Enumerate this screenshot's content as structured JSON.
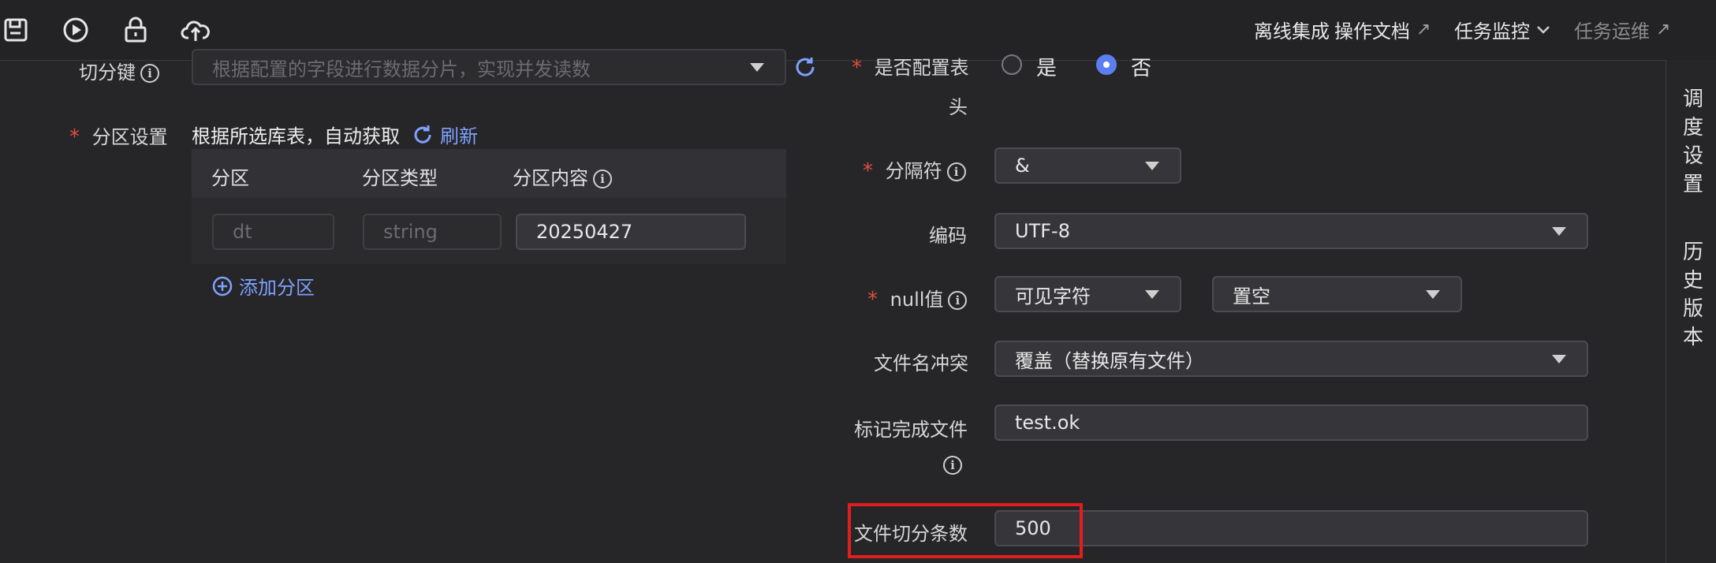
{
  "toolbar": {
    "icons": [
      "save-icon",
      "run-icon",
      "lock-icon",
      "upload-cloud-icon"
    ]
  },
  "nav": {
    "offline_integration": "离线集成",
    "docs": "操作文档",
    "docs_suffix": "↗",
    "task_monitor": "任务监控",
    "task_monitor_suffix": "⌄",
    "task_ops": "任务运维",
    "task_ops_suffix": "↗"
  },
  "left": {
    "split_key_label": "切分键",
    "split_key_placeholder": "根据配置的字段进行数据分片，实现并发读数",
    "partition_label": "分区设置",
    "partition_hint": "根据所选库表，自动获取",
    "refresh": "刷新",
    "table": {
      "headers": [
        "分区",
        "分区类型",
        "分区内容"
      ],
      "row": {
        "partition": "dt",
        "type": "string",
        "content": "20250427"
      }
    },
    "add_partition": "添加分区"
  },
  "right": {
    "header_config_label_1": "是否配置表",
    "header_config_label_2": "头",
    "radio_yes": "是",
    "radio_no": "否",
    "separator_label": "分隔符",
    "separator_value": "&",
    "encoding_label": "编码",
    "encoding_value": "UTF-8",
    "null_label": "null值",
    "null_type": "可见字符",
    "null_value": "置空",
    "conflict_label": "文件名冲突",
    "conflict_value": "覆盖（替换原有文件）",
    "done_file_label": "标记完成文件",
    "done_file_value": "test.ok",
    "split_count_label": "文件切分条数",
    "split_count_value": "500"
  },
  "rail": {
    "schedule": "调度设置",
    "history": "历史版本"
  },
  "colors": {
    "accent": "#5b7ff0",
    "link": "#7ea1ff",
    "required": "#e0503c",
    "highlight": "#e21d1d"
  }
}
